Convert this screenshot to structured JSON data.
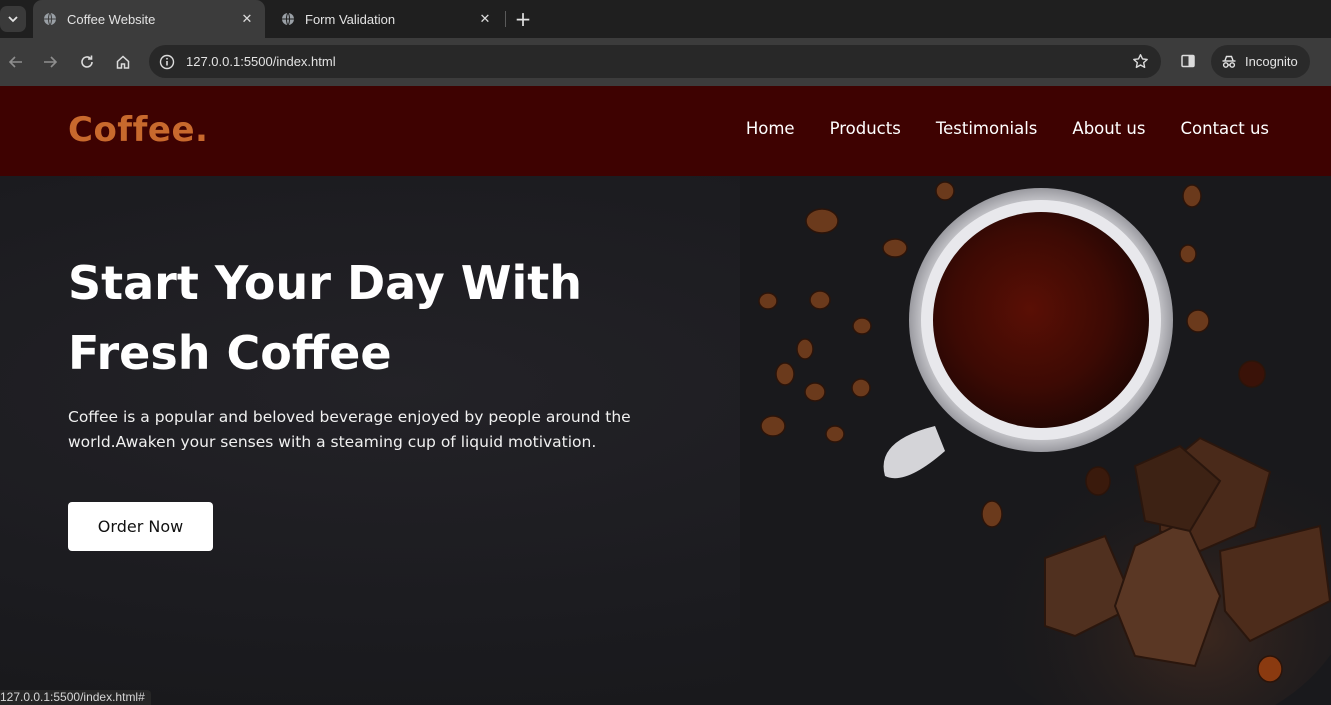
{
  "browser": {
    "tabs": [
      {
        "title": "Coffee Website",
        "active": true
      },
      {
        "title": "Form Validation",
        "active": false
      }
    ],
    "url": "127.0.0.1:5500/index.html",
    "incognito_label": "Incognito",
    "status_url": "127.0.0.1:5500/index.html#"
  },
  "site": {
    "logo": "Coffee.",
    "nav": [
      "Home",
      "Products",
      "Testimonials",
      "About us",
      "Contact us"
    ],
    "hero": {
      "title_line1": "Start Your Day With",
      "title_line2": "Fresh Coffee",
      "description": "Coffee is a popular and beloved beverage enjoyed by people around the world.Awaken your senses with a steaming cup of liquid motivation.",
      "button": "Order Now"
    }
  },
  "colors": {
    "nav_bg": "#3e0201",
    "logo": "#c8692d",
    "hero_bg": "#1b1b1f",
    "button_bg": "#ffffff"
  },
  "icons": {
    "tab_menu": "chevron-down-icon",
    "favicon": "globe-icon",
    "close": "close-icon",
    "new_tab": "plus-icon",
    "back": "arrow-left-icon",
    "forward": "arrow-right-icon",
    "reload": "reload-icon",
    "home": "home-icon",
    "site_info": "info-icon",
    "bookmark": "star-icon",
    "side_panel": "side-panel-icon",
    "incognito": "incognito-icon"
  }
}
